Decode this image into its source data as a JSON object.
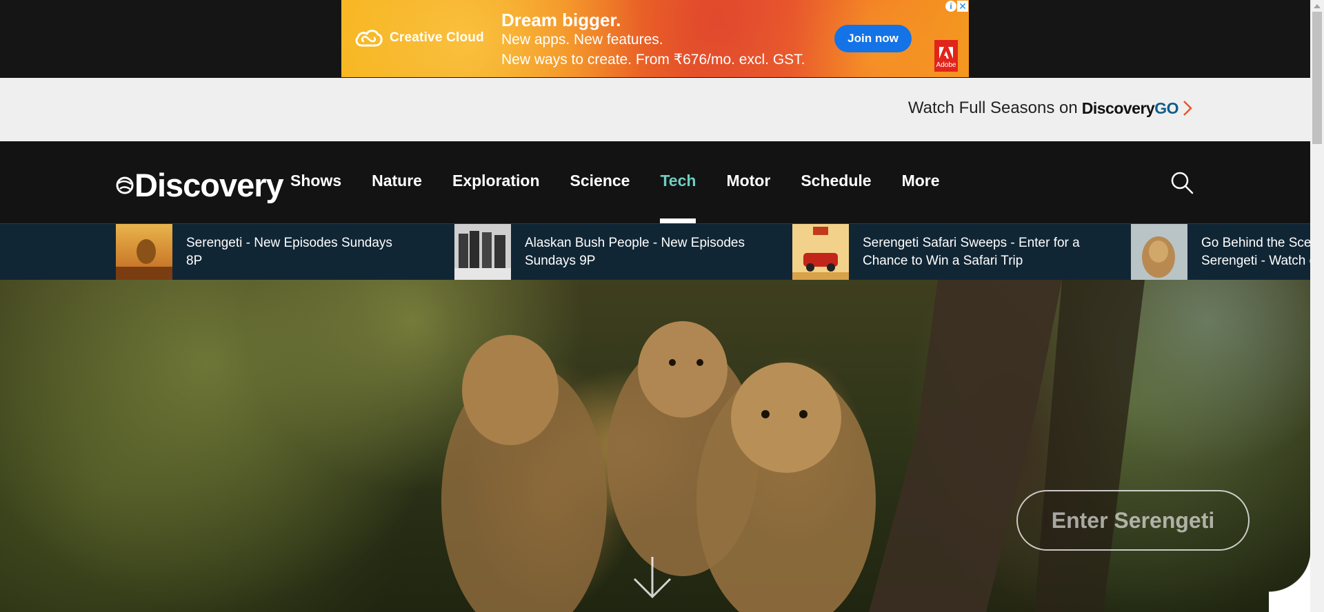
{
  "ad": {
    "brand": "Creative Cloud",
    "headline": "Dream bigger.",
    "line1": "New apps. New features.",
    "line2": "New ways to create. From ₹676/mo. excl. GST.",
    "cta": "Join now",
    "adobe_label": "Adobe",
    "info_glyph": "i",
    "close_glyph": "✕"
  },
  "promo": {
    "text": "Watch Full Seasons on",
    "logo_main": "Discovery",
    "logo_suffix": "GO"
  },
  "header": {
    "logo": "Discovery",
    "nav": [
      {
        "label": "Shows"
      },
      {
        "label": "Nature"
      },
      {
        "label": "Exploration"
      },
      {
        "label": "Science"
      },
      {
        "label": "Tech",
        "active": true
      },
      {
        "label": "Motor"
      },
      {
        "label": "Schedule"
      },
      {
        "label": "More"
      }
    ]
  },
  "ticker": {
    "items": [
      {
        "text": "Serengeti - New Episodes Sundays 8P"
      },
      {
        "text": "Alaskan Bush People - New Episodes Sundays 9P"
      },
      {
        "text": "Serengeti Safari Sweeps - Enter for a Chance to Win a Safari Trip"
      },
      {
        "text": "Go Behind the Scenes of Serengeti - Watch on GO"
      }
    ]
  },
  "hero": {
    "cta": "Enter Serengeti"
  },
  "colors": {
    "active_nav": "#6dcfc2",
    "go_blue": "#0f5d8c",
    "promo_chevron": "#e8562a",
    "ad_cta": "#1473e6"
  }
}
